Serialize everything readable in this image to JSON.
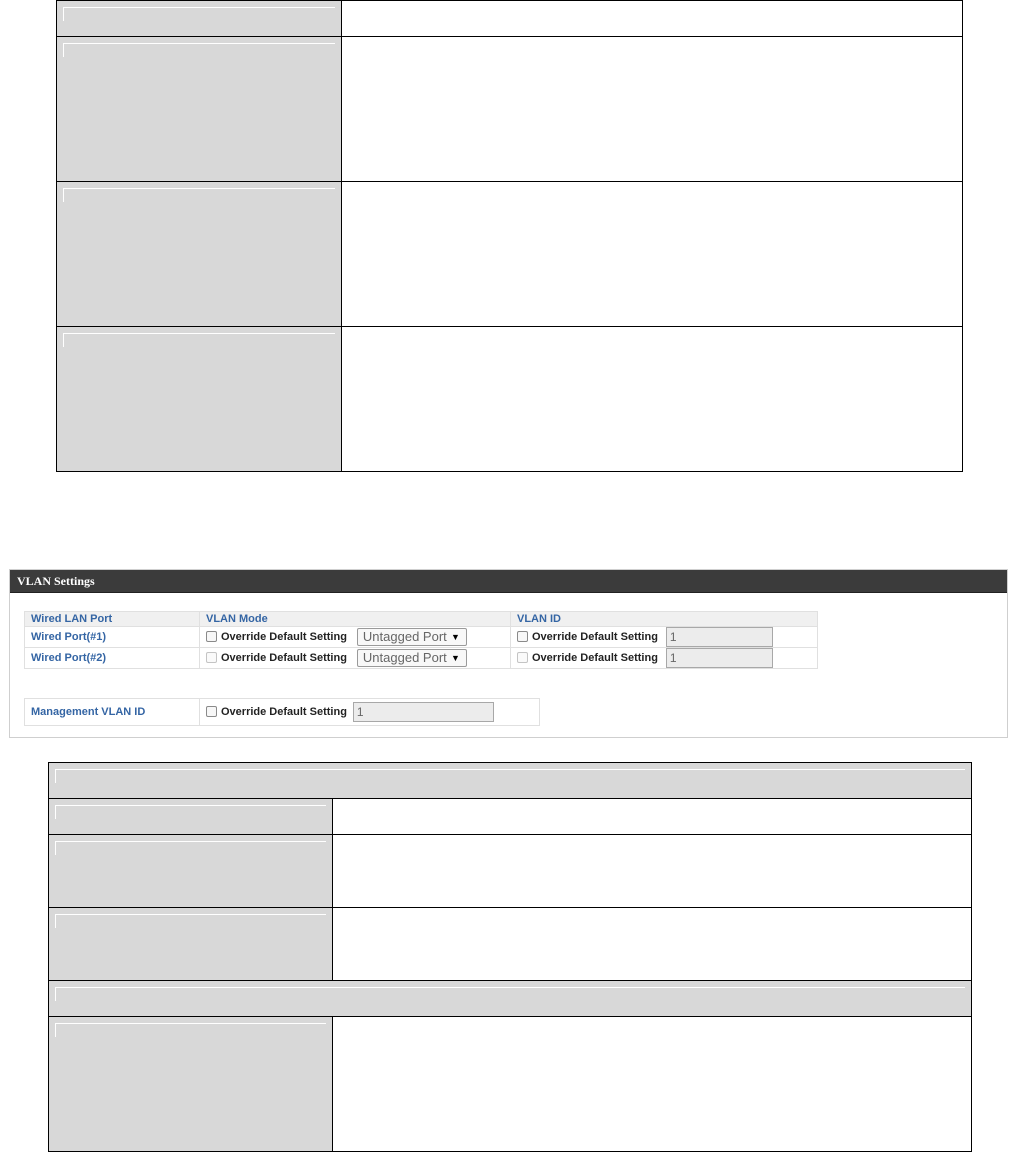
{
  "vlan_settings": {
    "title": "VLAN Settings",
    "headers": {
      "port": "Wired LAN Port",
      "mode": "VLAN Mode",
      "id": "VLAN ID"
    },
    "rows": [
      {
        "port": "Wired Port(#1)",
        "mode_override": "Override Default Setting",
        "mode_value": "Untagged Port",
        "id_override": "Override Default Setting",
        "id_value": "1"
      },
      {
        "port": "Wired Port(#2)",
        "mode_override": "Override Default Setting",
        "mode_value": "Untagged Port",
        "id_override": "Override Default Setting",
        "id_value": "1"
      }
    ],
    "management": {
      "label": "Management VLAN ID",
      "override": "Override Default Setting",
      "value": "1"
    }
  },
  "icons": {
    "dropdown": "triangle-down-icon",
    "checkbox": "checkbox-unchecked-icon"
  }
}
